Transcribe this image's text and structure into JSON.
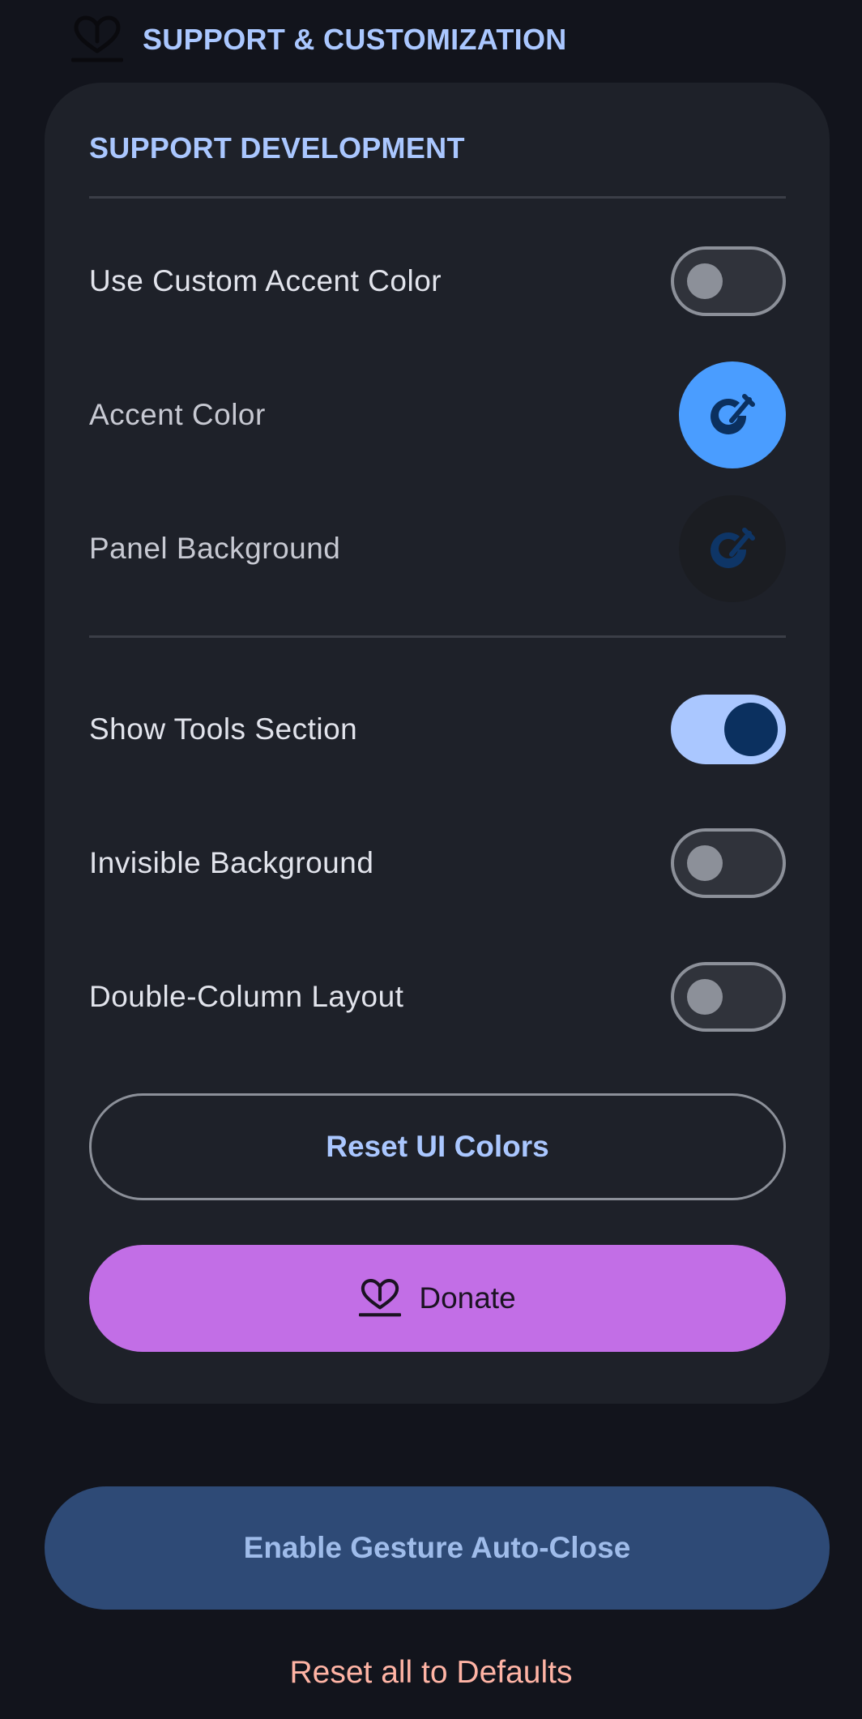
{
  "section": {
    "title": "SUPPORT & CUSTOMIZATION",
    "icon": "heart-hand-icon"
  },
  "card": {
    "title": "SUPPORT DEVELOPMENT",
    "rows": [
      {
        "label": "Use Custom Accent Color",
        "control": "switch",
        "checked": false
      },
      {
        "label": "Accent Color",
        "control": "color",
        "color": "#4a9dff",
        "icon": "color-picker-icon"
      },
      {
        "label": "Panel Background",
        "control": "color",
        "color": "#1b1d22",
        "icon": "color-picker-icon"
      },
      {
        "label": "Show Tools Section",
        "control": "switch",
        "checked": true
      },
      {
        "label": "Invisible Background",
        "control": "switch",
        "checked": false
      },
      {
        "label": "Double-Column Layout",
        "control": "switch",
        "checked": false
      }
    ],
    "reset_colors_label": "Reset UI Colors",
    "donate_label": "Donate",
    "donate_icon": "heart-hand-icon"
  },
  "footer": {
    "gesture_label": "Enable Gesture Auto-Close",
    "reset_all_label": "Reset all to Defaults"
  },
  "colors": {
    "accent": "#aac7ff",
    "donate": "#c26ee6",
    "gesture_button": "#2e4a76",
    "reset_link": "#ffb4a5"
  }
}
